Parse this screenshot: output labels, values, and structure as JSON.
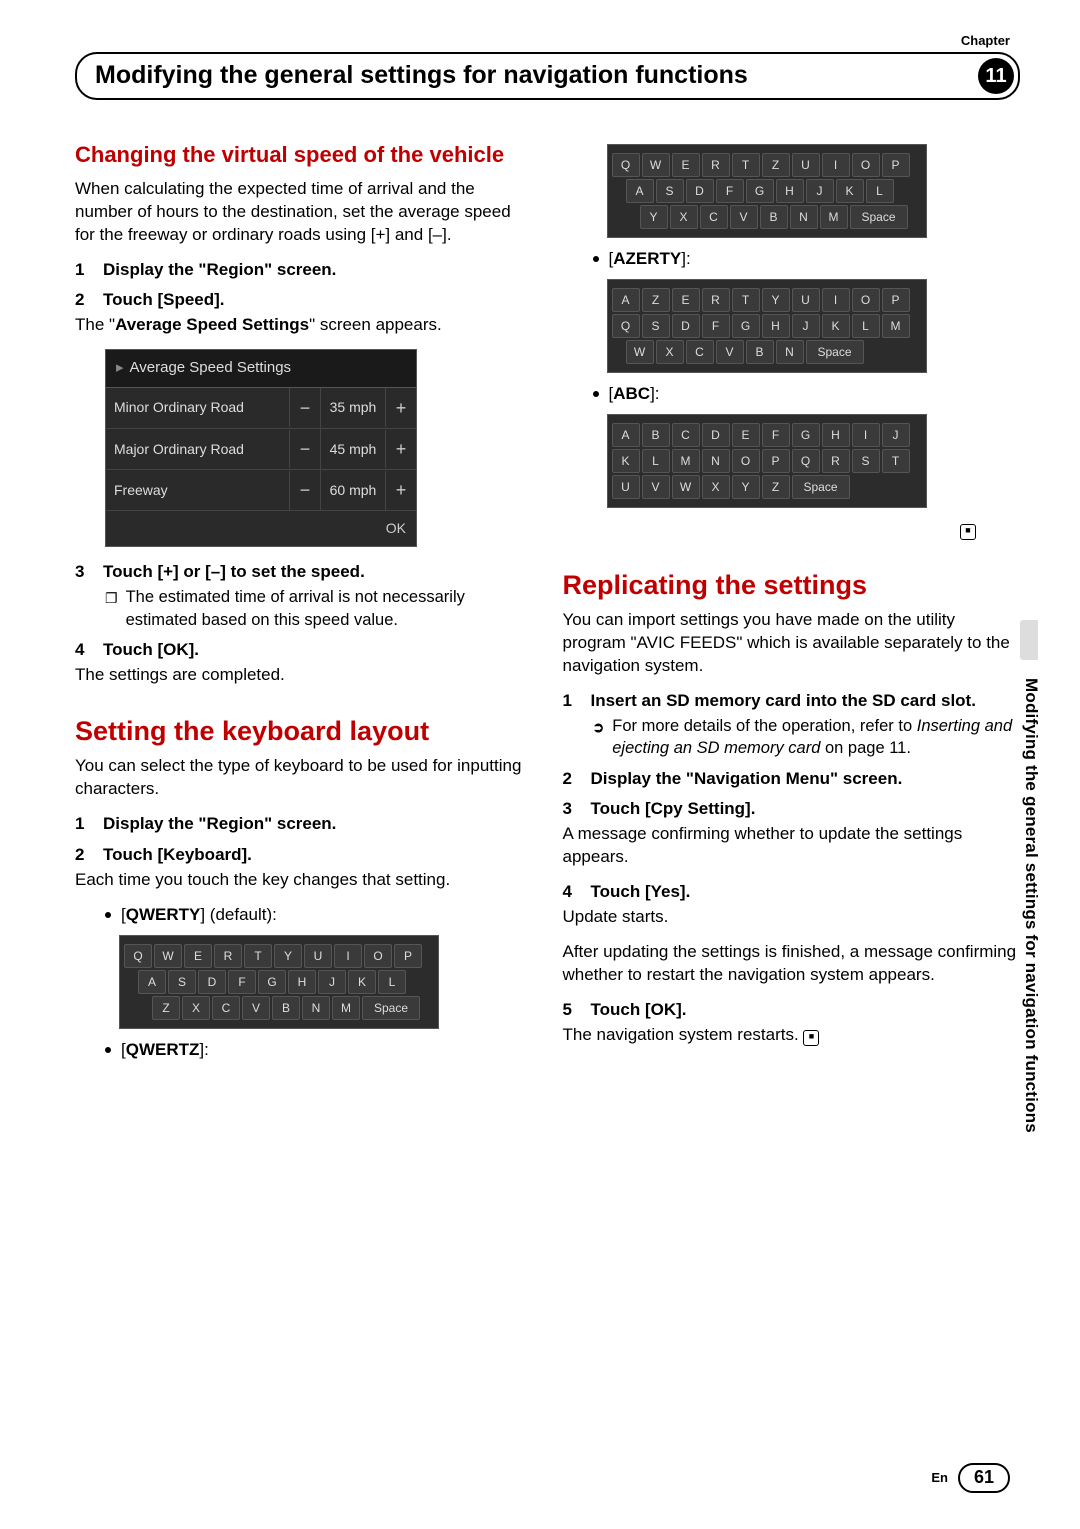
{
  "chapter_label": "Chapter",
  "chapter_number": "11",
  "header_title": "Modifying the general settings for navigation functions",
  "side_text": "Modifying the general settings for navigation functions",
  "page_lang": "En",
  "page_number": "61",
  "left": {
    "h1": "Changing the virtual speed of the vehicle",
    "p1": "When calculating the expected time of arrival and the number of hours to the destination, set the average speed for the freeway or ordinary roads using [+] and [–].",
    "s1": "Display the \"Region\" screen.",
    "s2": "Touch [Speed].",
    "p2a": "The \"",
    "p2b": "Average Speed Settings",
    "p2c": "\" screen appears.",
    "speed": {
      "title": "Average Speed Settings",
      "rows": [
        {
          "label": "Minor Ordinary Road",
          "val": "35 mph"
        },
        {
          "label": "Major Ordinary Road",
          "val": "45 mph"
        },
        {
          "label": "Freeway",
          "val": "60 mph"
        }
      ],
      "ok": "OK"
    },
    "s3": "Touch [+] or [–] to set the speed.",
    "note1": "The estimated time of arrival is not necessarily estimated based on this speed value.",
    "s4": "Touch [OK].",
    "p4": "The settings are completed.",
    "h2": "Setting the keyboard layout",
    "p5": "You can select the type of keyboard to be used for inputting characters.",
    "s1b": "Display the \"Region\" screen.",
    "s2b": "Touch [Keyboard].",
    "p6": "Each time you touch the key changes that setting.",
    "kb_qwerty_label_a": "[",
    "kb_qwerty_label_b": "QWERTY",
    "kb_qwerty_label_c": "] (default):",
    "kb_qwertz_label_a": "[",
    "kb_qwertz_label_b": "QWERTZ",
    "kb_qwertz_label_c": "]:"
  },
  "right": {
    "kb_azerty_label_a": "[",
    "kb_azerty_label_b": "AZERTY",
    "kb_azerty_label_c": "]:",
    "kb_abc_label_a": "[",
    "kb_abc_label_b": "ABC",
    "kb_abc_label_c": "]:",
    "h1": "Replicating the settings",
    "p1": "You can import settings you have made on the utility program \"AVIC FEEDS\" which is available separately to the navigation system.",
    "s1": "Insert an SD memory card into the SD card slot.",
    "ref_a": "For more details of the operation, refer to ",
    "ref_b": "Inserting and ejecting an SD memory card",
    "ref_c": " on page 11.",
    "s2": "Display the \"Navigation Menu\" screen.",
    "s3": "Touch [Cpy Setting].",
    "p3": "A message confirming whether to update the settings appears.",
    "s4": "Touch [Yes].",
    "p4a": "Update starts.",
    "p4b": "After updating the settings is finished, a message confirming whether to restart the navigation system appears.",
    "s5": "Touch [OK].",
    "p5": "The navigation system restarts."
  },
  "kbd": {
    "qwerty": [
      [
        "Q",
        "W",
        "E",
        "R",
        "T",
        "Y",
        "U",
        "I",
        "O",
        "P"
      ],
      [
        "A",
        "S",
        "D",
        "F",
        "G",
        "H",
        "J",
        "K",
        "L"
      ],
      [
        "Z",
        "X",
        "C",
        "V",
        "B",
        "N",
        "M",
        "Space"
      ]
    ],
    "qwertz": [
      [
        "Q",
        "W",
        "E",
        "R",
        "T",
        "Z",
        "U",
        "I",
        "O",
        "P"
      ],
      [
        "A",
        "S",
        "D",
        "F",
        "G",
        "H",
        "J",
        "K",
        "L"
      ],
      [
        "Y",
        "X",
        "C",
        "V",
        "B",
        "N",
        "M",
        "Space"
      ]
    ],
    "azerty": [
      [
        "A",
        "Z",
        "E",
        "R",
        "T",
        "Y",
        "U",
        "I",
        "O",
        "P"
      ],
      [
        "Q",
        "S",
        "D",
        "F",
        "G",
        "H",
        "J",
        "K",
        "L",
        "M"
      ],
      [
        "W",
        "X",
        "C",
        "V",
        "B",
        "N",
        "Space"
      ]
    ],
    "abc": [
      [
        "A",
        "B",
        "C",
        "D",
        "E",
        "F",
        "G",
        "H",
        "I",
        "J"
      ],
      [
        "K",
        "L",
        "M",
        "N",
        "O",
        "P",
        "Q",
        "R",
        "S",
        "T"
      ],
      [
        "U",
        "V",
        "W",
        "X",
        "Y",
        "Z",
        "Space"
      ]
    ]
  }
}
